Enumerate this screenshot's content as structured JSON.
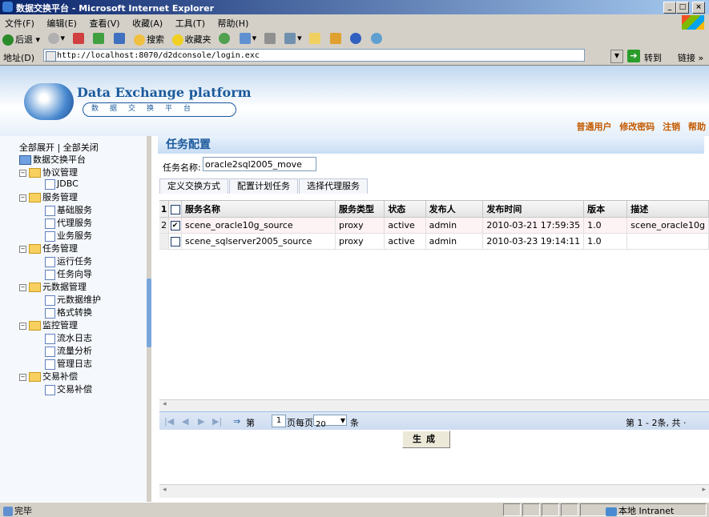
{
  "window": {
    "title": "数据交换平台 - Microsoft Internet Explorer"
  },
  "menu": [
    "文件(F)",
    "编辑(E)",
    "查看(V)",
    "收藏(A)",
    "工具(T)",
    "帮助(H)"
  ],
  "toolbar": {
    "back": "后退",
    "search": "搜索",
    "favorites": "收藏夹"
  },
  "address": {
    "label": "地址(D)",
    "url": "http://localhost:8070/d2dconsole/login.exc",
    "go": "转到",
    "links": "链接 »"
  },
  "header": {
    "logo_title": "Data Exchange platform",
    "logo_sub": "数据交换平台",
    "user_links": [
      "普通用户",
      "修改密码",
      "注销",
      "帮助"
    ]
  },
  "sidebar": {
    "expand_all": "全部展开",
    "sep": "|",
    "collapse_all": "全部关闭",
    "root": "数据交换平台",
    "items": [
      {
        "label": "协议管理",
        "type": "folder"
      },
      {
        "label": "JDBC",
        "type": "leaf"
      },
      {
        "label": "服务管理",
        "type": "folder"
      },
      {
        "label": "基础服务",
        "type": "leaf"
      },
      {
        "label": "代理服务",
        "type": "leaf"
      },
      {
        "label": "业务服务",
        "type": "leaf"
      },
      {
        "label": "任务管理",
        "type": "folder"
      },
      {
        "label": "运行任务",
        "type": "leaf"
      },
      {
        "label": "任务向导",
        "type": "leaf"
      },
      {
        "label": "元数据管理",
        "type": "folder"
      },
      {
        "label": "元数据维护",
        "type": "leaf"
      },
      {
        "label": "格式转换",
        "type": "leaf"
      },
      {
        "label": "监控管理",
        "type": "folder"
      },
      {
        "label": "流水日志",
        "type": "leaf"
      },
      {
        "label": "流量分析",
        "type": "leaf"
      },
      {
        "label": "管理日志",
        "type": "leaf"
      },
      {
        "label": "交易补偿",
        "type": "folder"
      },
      {
        "label": "交易补偿",
        "type": "leaf"
      }
    ]
  },
  "main": {
    "title": "任务配置",
    "task_name_label": "任务名称:",
    "task_name_value": "oracle2sql2005_move",
    "tabs": [
      "定义交换方式",
      "配置计划任务",
      "选择代理服务"
    ],
    "columns": [
      "服务名称",
      "服务类型",
      "状态",
      "发布人",
      "发布时间",
      "版本",
      "描述"
    ],
    "rows": [
      {
        "num": "2",
        "checked": true,
        "cells": [
          "scene_oracle10g_source",
          "proxy",
          "active",
          "admin",
          "2010-03-21 17:59:35",
          "1.0",
          "scene_oracle10g"
        ]
      },
      {
        "num": "",
        "checked": false,
        "cells": [
          "scene_sqlserver2005_source",
          "proxy",
          "active",
          "admin",
          "2010-03-23 19:14:11",
          "1.0",
          ""
        ]
      }
    ],
    "header_rownum": "1",
    "pager": {
      "first": "|◀",
      "prev": "◀",
      "next": "▶",
      "last": "▶|",
      "go": "⇒",
      "page_prefix": "第",
      "page_value": "1",
      "page_suffix": "页",
      "per_page_label": "每页",
      "per_page_value": "20",
      "per_page_unit": "条",
      "summary": "第 1 - 2条, 共 ·"
    },
    "generate_button": "生成"
  },
  "status": {
    "text": "完毕",
    "zone": "本地 Intranet"
  }
}
